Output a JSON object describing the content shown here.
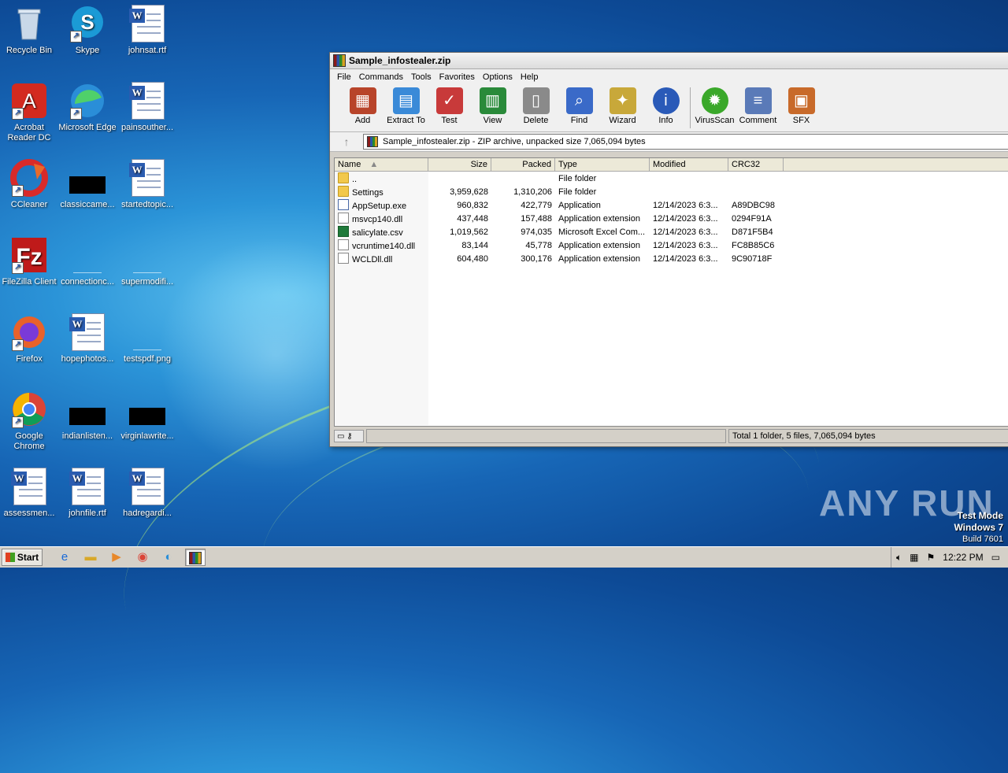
{
  "desktop": {
    "icons": [
      {
        "label": "Recycle Bin"
      },
      {
        "label": "Skype"
      },
      {
        "label": "johnsat.rtf"
      },
      {
        "label": "Acrobat Reader DC"
      },
      {
        "label": "Microsoft Edge"
      },
      {
        "label": "painsouther..."
      },
      {
        "label": "CCleaner"
      },
      {
        "label": "classiccame..."
      },
      {
        "label": "startedtopic..."
      },
      {
        "label": "FileZilla Client"
      },
      {
        "label": "connectionc..."
      },
      {
        "label": "supermodifi..."
      },
      {
        "label": "Firefox"
      },
      {
        "label": "hopephotos..."
      },
      {
        "label": "testspdf.png"
      },
      {
        "label": "Google Chrome"
      },
      {
        "label": "indianlisten..."
      },
      {
        "label": "virginlawrite..."
      },
      {
        "label": "assessmen..."
      },
      {
        "label": "johnfile.rtf"
      },
      {
        "label": "hadregardi..."
      }
    ]
  },
  "window": {
    "title": "Sample_infostealer.zip",
    "menu": [
      "File",
      "Commands",
      "Tools",
      "Favorites",
      "Options",
      "Help"
    ],
    "toolbar": [
      {
        "label": "Add",
        "icon": "add-icon",
        "color": "#b8442a"
      },
      {
        "label": "Extract To",
        "icon": "extract-folder-icon",
        "color": "#3a8ad8"
      },
      {
        "label": "Test",
        "icon": "test-clipboard-icon",
        "color": "#c83a3a"
      },
      {
        "label": "View",
        "icon": "view-book-icon",
        "color": "#2a8a3a"
      },
      {
        "label": "Delete",
        "icon": "delete-trash-icon",
        "color": "#8a8a8a"
      },
      {
        "label": "Find",
        "icon": "find-magnifier-icon",
        "color": "#3a6ac8"
      },
      {
        "label": "Wizard",
        "icon": "wizard-wand-icon",
        "color": "#c8a83a"
      },
      {
        "label": "Info",
        "icon": "info-icon",
        "color": "#2a5ab8"
      },
      {
        "label": "VirusScan",
        "icon": "virusscan-bug-icon",
        "color": "#3aa82a"
      },
      {
        "label": "Comment",
        "icon": "comment-icon",
        "color": "#5a7ab8"
      },
      {
        "label": "SFX",
        "icon": "sfx-icon",
        "color": "#c86a2a"
      }
    ],
    "address": "Sample_infostealer.zip - ZIP archive, unpacked size 7,065,094 bytes",
    "columns": [
      "Name",
      "Size",
      "Packed",
      "Type",
      "Modified",
      "CRC32"
    ],
    "files": [
      {
        "name": "..",
        "size": "",
        "packed": "",
        "type": "File folder",
        "modified": "",
        "crc": "",
        "kind": "fold"
      },
      {
        "name": "Settings",
        "size": "3,959,628",
        "packed": "1,310,206",
        "type": "File folder",
        "modified": "",
        "crc": "",
        "kind": "fold"
      },
      {
        "name": "AppSetup.exe",
        "size": "960,832",
        "packed": "422,779",
        "type": "Application",
        "modified": "12/14/2023 6:3...",
        "crc": "A89DBC98",
        "kind": "exe"
      },
      {
        "name": "msvcp140.dll",
        "size": "437,448",
        "packed": "157,488",
        "type": "Application extension",
        "modified": "12/14/2023 6:3...",
        "crc": "0294F91A",
        "kind": "dll"
      },
      {
        "name": "salicylate.csv",
        "size": "1,019,562",
        "packed": "974,035",
        "type": "Microsoft Excel Com...",
        "modified": "12/14/2023 6:3...",
        "crc": "D871F5B4",
        "kind": "xls"
      },
      {
        "name": "vcruntime140.dll",
        "size": "83,144",
        "packed": "45,778",
        "type": "Application extension",
        "modified": "12/14/2023 6:3...",
        "crc": "FC8B85C6",
        "kind": "dll"
      },
      {
        "name": "WCLDll.dll",
        "size": "604,480",
        "packed": "300,176",
        "type": "Application extension",
        "modified": "12/14/2023 6:3...",
        "crc": "9C90718F",
        "kind": "dll"
      }
    ],
    "status": "Total 1 folder, 5 files, 7,065,094 bytes"
  },
  "taskbar": {
    "start": "Start",
    "clock": "12:22 PM"
  },
  "watermark": "ANY RUN",
  "testmode": {
    "line1": "Test Mode",
    "line2": "Windows 7",
    "line3": "Build 7601"
  }
}
